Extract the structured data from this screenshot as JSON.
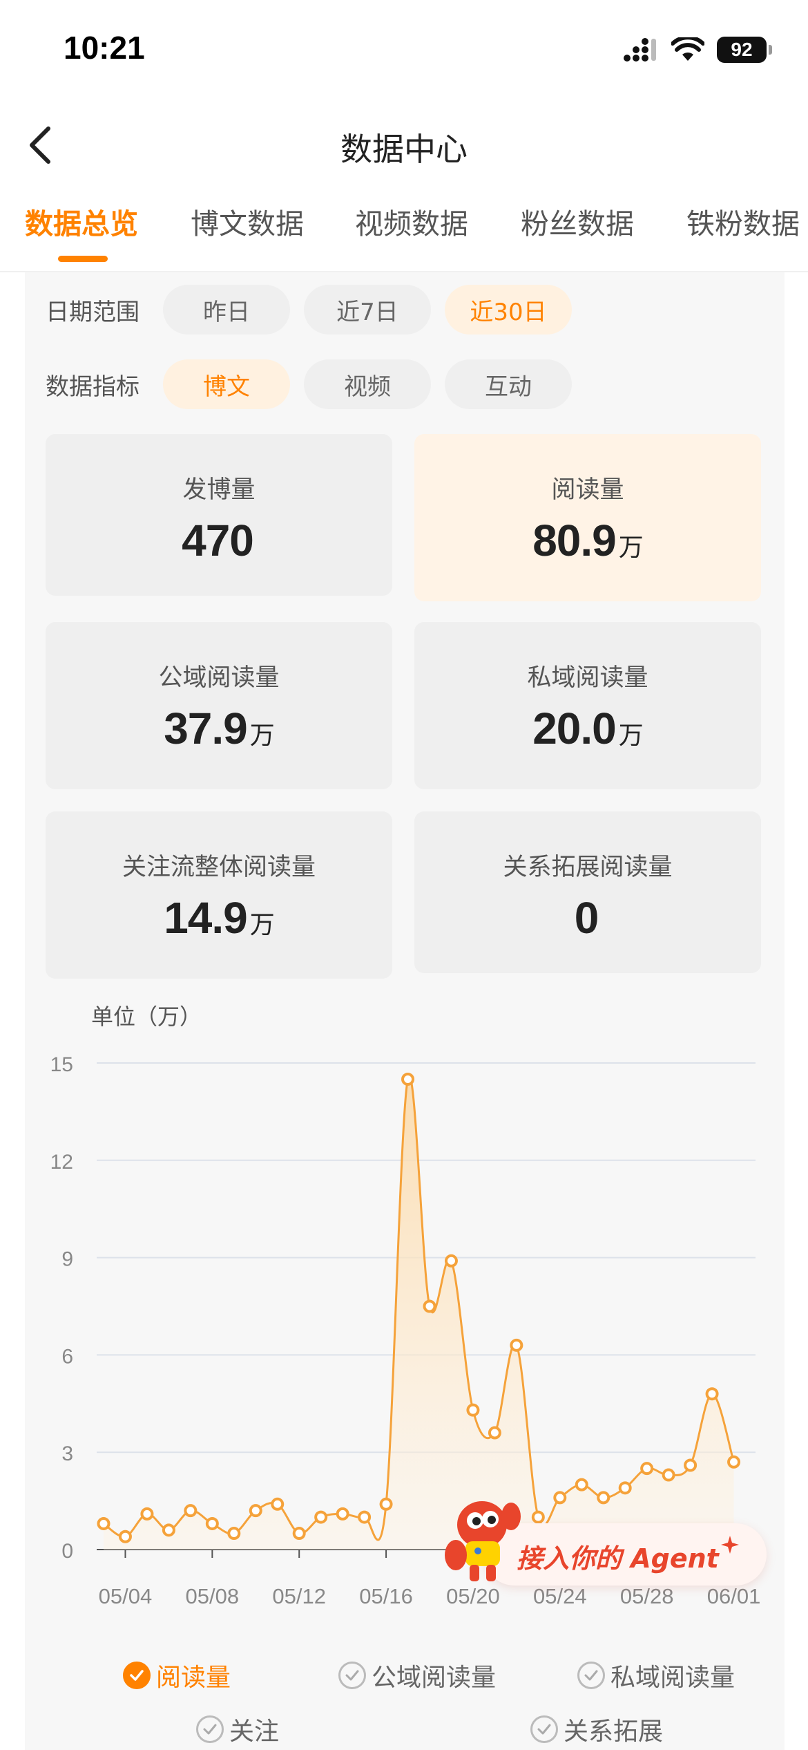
{
  "status_bar": {
    "time": "10:21",
    "battery": "92"
  },
  "nav": {
    "title": "数据中心"
  },
  "tabs": [
    {
      "label": "数据总览",
      "active": true
    },
    {
      "label": "博文数据",
      "active": false
    },
    {
      "label": "视频数据",
      "active": false
    },
    {
      "label": "粉丝数据",
      "active": false
    },
    {
      "label": "铁粉数据",
      "active": false
    }
  ],
  "filters": {
    "date_label": "日期范围",
    "date_options": [
      "昨日",
      "近7日",
      "近30日"
    ],
    "date_selected": "近30日",
    "metric_label": "数据指标",
    "metric_options": [
      "博文",
      "视频",
      "互动"
    ],
    "metric_selected": "博文"
  },
  "cards": [
    {
      "label": "发博量",
      "value": "470",
      "unit": ""
    },
    {
      "label": "阅读量",
      "value": "80.9",
      "unit": "万"
    },
    {
      "label": "公域阅读量",
      "value": "37.9",
      "unit": "万"
    },
    {
      "label": "私域阅读量",
      "value": "20.0",
      "unit": "万"
    },
    {
      "label": "关注流整体阅读量",
      "value": "14.9",
      "unit": "万"
    },
    {
      "label": "关系拓展阅读量",
      "value": "0",
      "unit": ""
    }
  ],
  "agent": {
    "label": "接入你的 Agent"
  },
  "legend": [
    {
      "label": "阅读量",
      "active": true
    },
    {
      "label": "公域阅读量",
      "active": false
    },
    {
      "label": "私域阅读量",
      "active": false
    },
    {
      "label": "关注",
      "active": false
    },
    {
      "label": "关系拓展",
      "active": false
    }
  ],
  "colors": {
    "accent": "#ff8200",
    "line": "#f5a23a",
    "agent": "#e8452c"
  },
  "chart_data": {
    "type": "area",
    "unit_label": "单位（万）",
    "ylim": [
      0,
      15
    ],
    "yticks": [
      0,
      3,
      6,
      9,
      12,
      15
    ],
    "xtick_labels": [
      "05/04",
      "05/08",
      "05/12",
      "05/16",
      "05/20",
      "05/24",
      "05/28",
      "06/01"
    ],
    "x": [
      "05/03",
      "05/04",
      "05/05",
      "05/06",
      "05/07",
      "05/08",
      "05/09",
      "05/10",
      "05/11",
      "05/12",
      "05/13",
      "05/14",
      "05/15",
      "05/16",
      "05/17",
      "05/18",
      "05/19",
      "05/20",
      "05/21",
      "05/22",
      "05/23",
      "05/24",
      "05/25",
      "05/26",
      "05/27",
      "05/28",
      "05/29",
      "05/30",
      "05/31",
      "06/01",
      "06/02"
    ],
    "series": [
      {
        "name": "阅读量",
        "values": [
          0.8,
          0.4,
          1.1,
          0.6,
          1.2,
          0.8,
          0.5,
          1.2,
          1.4,
          0.5,
          1.0,
          1.1,
          1.0,
          1.4,
          14.5,
          7.5,
          8.9,
          4.3,
          3.6,
          6.3,
          1.0,
          1.6,
          2.0,
          1.6,
          1.9,
          2.5,
          2.3,
          2.6,
          4.8,
          2.7,
          null
        ]
      }
    ],
    "grid": true
  }
}
